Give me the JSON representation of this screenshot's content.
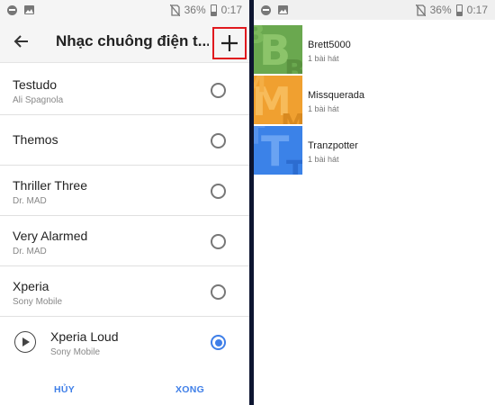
{
  "left": {
    "status": {
      "battery": "36%",
      "time": "0:17"
    },
    "header": {
      "title": "Nhạc chuông điện t..."
    },
    "ringtones": [
      {
        "name": "Testudo",
        "artist": "Ali Spagnola",
        "selected": false
      },
      {
        "name": "Themos",
        "artist": "",
        "selected": false
      },
      {
        "name": "Thriller Three",
        "artist": "Dr. MAD",
        "selected": false
      },
      {
        "name": "Very Alarmed",
        "artist": "Dr. MAD",
        "selected": false
      },
      {
        "name": "Xperia",
        "artist": "Sony Mobile",
        "selected": false
      },
      {
        "name": "Xperia Loud",
        "artist": "Sony Mobile",
        "selected": true
      }
    ],
    "footer": {
      "cancel": "HỦY",
      "done": "XONG"
    }
  },
  "right": {
    "status": {
      "battery": "36%",
      "time": "0:17"
    },
    "albums": [
      {
        "name": "Brett5000",
        "count": "1 bài hát",
        "color": "#6aa84f",
        "letter": "B"
      },
      {
        "name": "Missquerada",
        "count": "1 bài hát",
        "color": "#f0a030",
        "letter": "M"
      },
      {
        "name": "Tranzpotter",
        "count": "1 bài hát",
        "color": "#3b82e8",
        "letter": "T"
      }
    ]
  },
  "colors": {
    "accent": "#3f7fe8",
    "highlight": "#e0191e"
  }
}
